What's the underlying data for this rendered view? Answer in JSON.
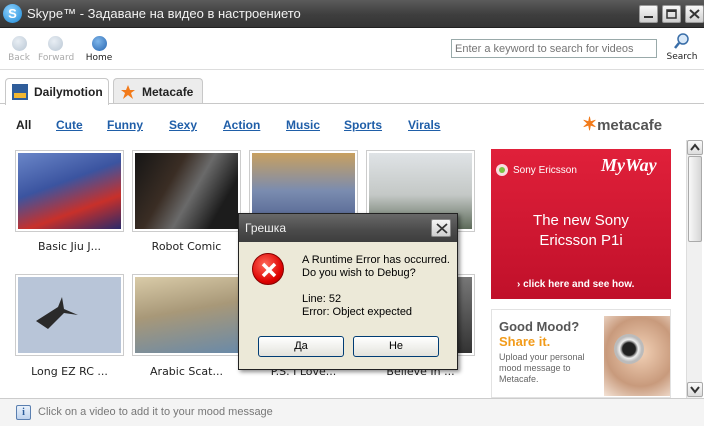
{
  "window": {
    "title": "Skype™ - Задаване на видео в настроението",
    "logo_letter": "S"
  },
  "toolbar": {
    "back_label": "Back",
    "forward_label": "Forward",
    "home_label": "Home",
    "search_placeholder": "Enter a keyword to search for videos",
    "search_label": "Search"
  },
  "tabs": [
    {
      "label": "Dailymotion",
      "active": true
    },
    {
      "label": "Metacafe",
      "active": false
    }
  ],
  "categories": [
    "All",
    "Cute",
    "Funny",
    "Sexy",
    "Action",
    "Music",
    "Sports",
    "Virals"
  ],
  "current_category": "All",
  "brand_logo": "metacafe",
  "videos": [
    {
      "caption": "Basic Jiu J..."
    },
    {
      "caption": "Robot Comic"
    },
    {
      "caption": ""
    },
    {
      "caption": ""
    },
    {
      "caption": "Long EZ RC ..."
    },
    {
      "caption": "Arabic Scat..."
    },
    {
      "caption": "P.S. I Love..."
    },
    {
      "caption": "Believe In ..."
    }
  ],
  "ads": {
    "sony": {
      "brand": "Sony Ericsson",
      "tagline": "MyWay",
      "headline_1": "The new Sony",
      "headline_2": "Ericsson P1i",
      "cta": "› click here and see how."
    },
    "mood": {
      "line1": "Good Mood?",
      "line2": "Share it.",
      "body": "Upload your personal mood message to Metacafe."
    }
  },
  "status": {
    "icon": "i",
    "text": "Click on a video to add it to your mood message"
  },
  "dialog": {
    "title": "Грешка",
    "line1": "A Runtime Error has occurred.",
    "line2": "Do you wish to Debug?",
    "line3": "Line: 52",
    "line4": "Error: Object expected",
    "yes_label": "Да",
    "no_label": "Не"
  },
  "colors": {
    "accent_link": "#1f5ea8",
    "ad_red": "#d0142f",
    "metacafe_orange": "#f27a1a",
    "error_red": "#dd0000"
  }
}
